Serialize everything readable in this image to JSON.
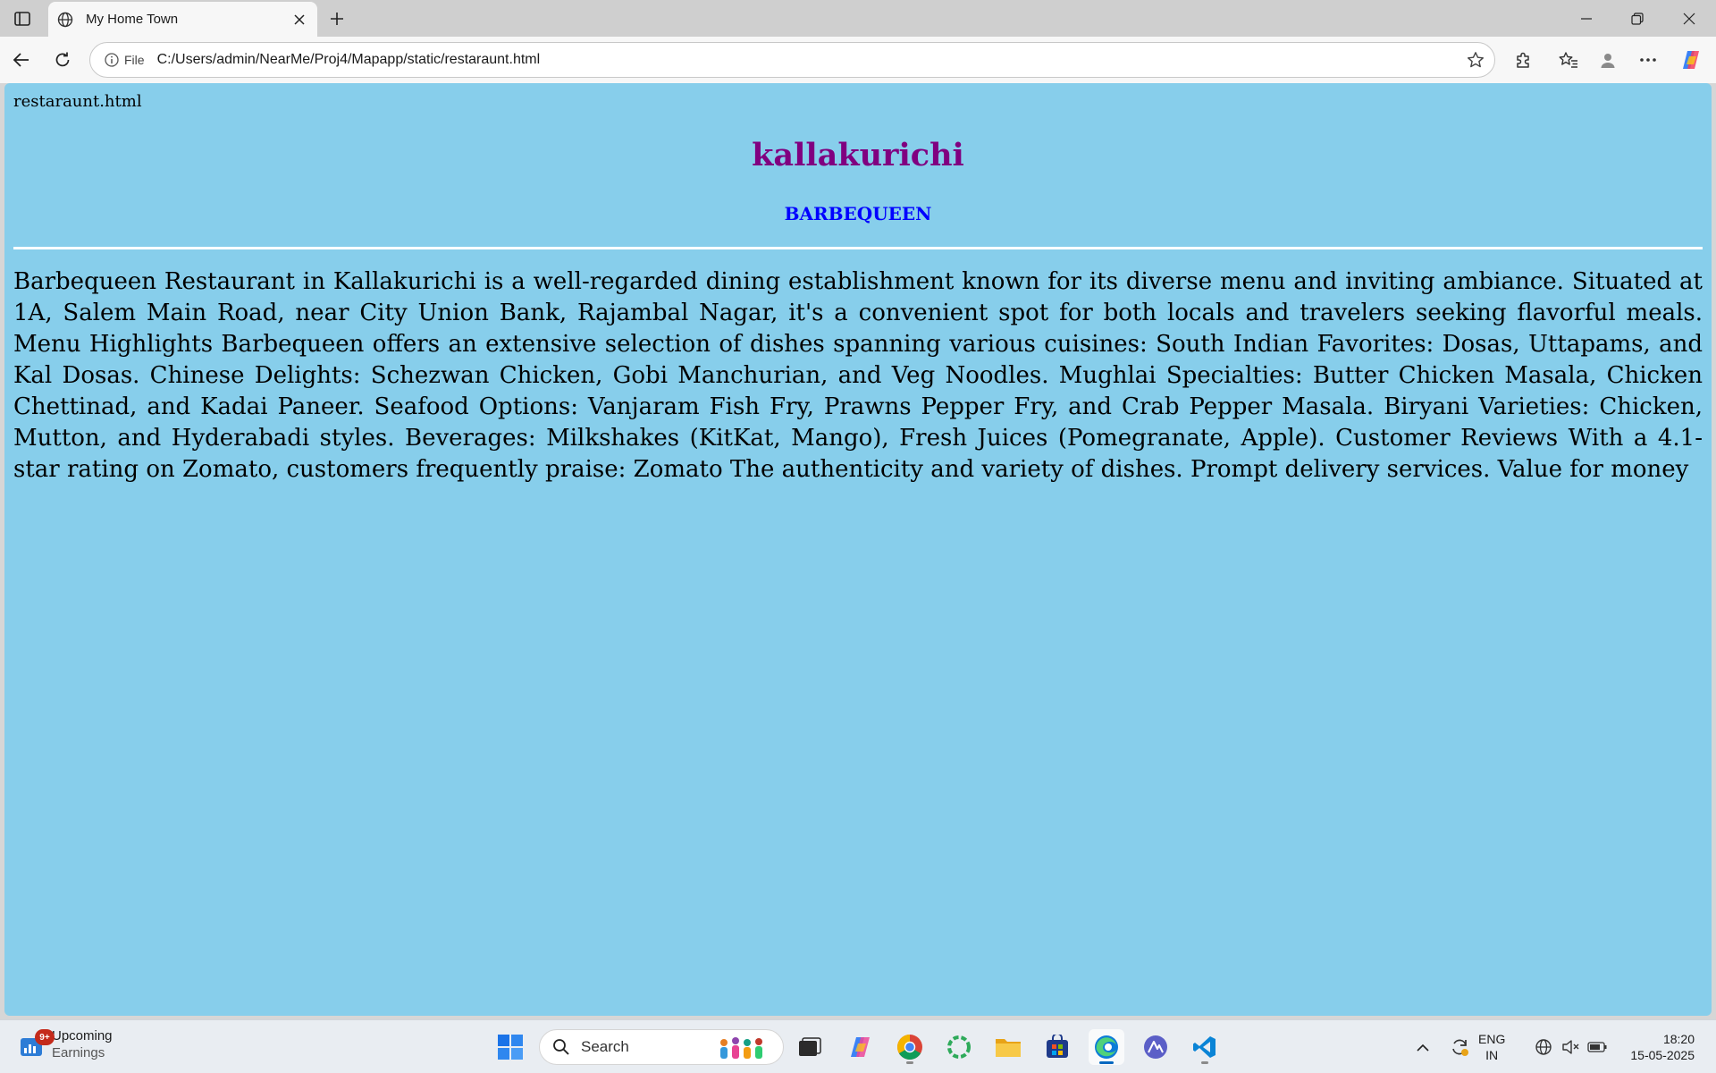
{
  "browser": {
    "tab_title": "My Home Town",
    "site_info_label": "File",
    "url": "C:/Users/admin/NearMe/Proj4/Mapapp/static/restaraunt.html"
  },
  "page": {
    "file_label": "restaraunt.html",
    "heading": "kallakurichi",
    "subheading": "BARBEQUEEN",
    "description": "Barbequeen Restaurant in Kallakurichi is a well-regarded dining establishment known for its diverse menu and inviting ambiance. Situated at 1A, Salem Main Road, near City Union Bank, Rajambal Nagar, it's a convenient spot for both locals and travelers seeking flavorful meals. Menu Highlights Barbequeen offers an extensive selection of dishes spanning various cuisines: South Indian Favorites: Dosas, Uttapams, and Kal Dosas. Chinese Delights: Schezwan Chicken, Gobi Manchurian, and Veg Noodles. Mughlai Specialties: Butter Chicken Masala, Chicken Chettinad, and Kadai Paneer. Seafood Options: Vanjaram Fish Fry, Prawns Pepper Fry, and Crab Pepper Masala. Biryani Varieties: Chicken, Mutton, and Hyderabadi styles. Beverages: Milkshakes (KitKat, Mango), Fresh Juices (Pomegranate, Apple). Customer Reviews With a 4.1-star rating on Zomato, customers frequently praise: Zomato The authenticity and variety of dishes. Prompt delivery services. Value for money",
    "colors": {
      "background": "#87ceeb",
      "heading": "#800080",
      "subheading": "#0000ff"
    }
  },
  "taskbar": {
    "widget_badge": "9+",
    "widget_title": "Upcoming",
    "widget_subtitle": "Earnings",
    "search_placeholder": "Search",
    "lang_line1": "ENG",
    "lang_line2": "IN",
    "time": "18:20",
    "date": "15-05-2025"
  }
}
